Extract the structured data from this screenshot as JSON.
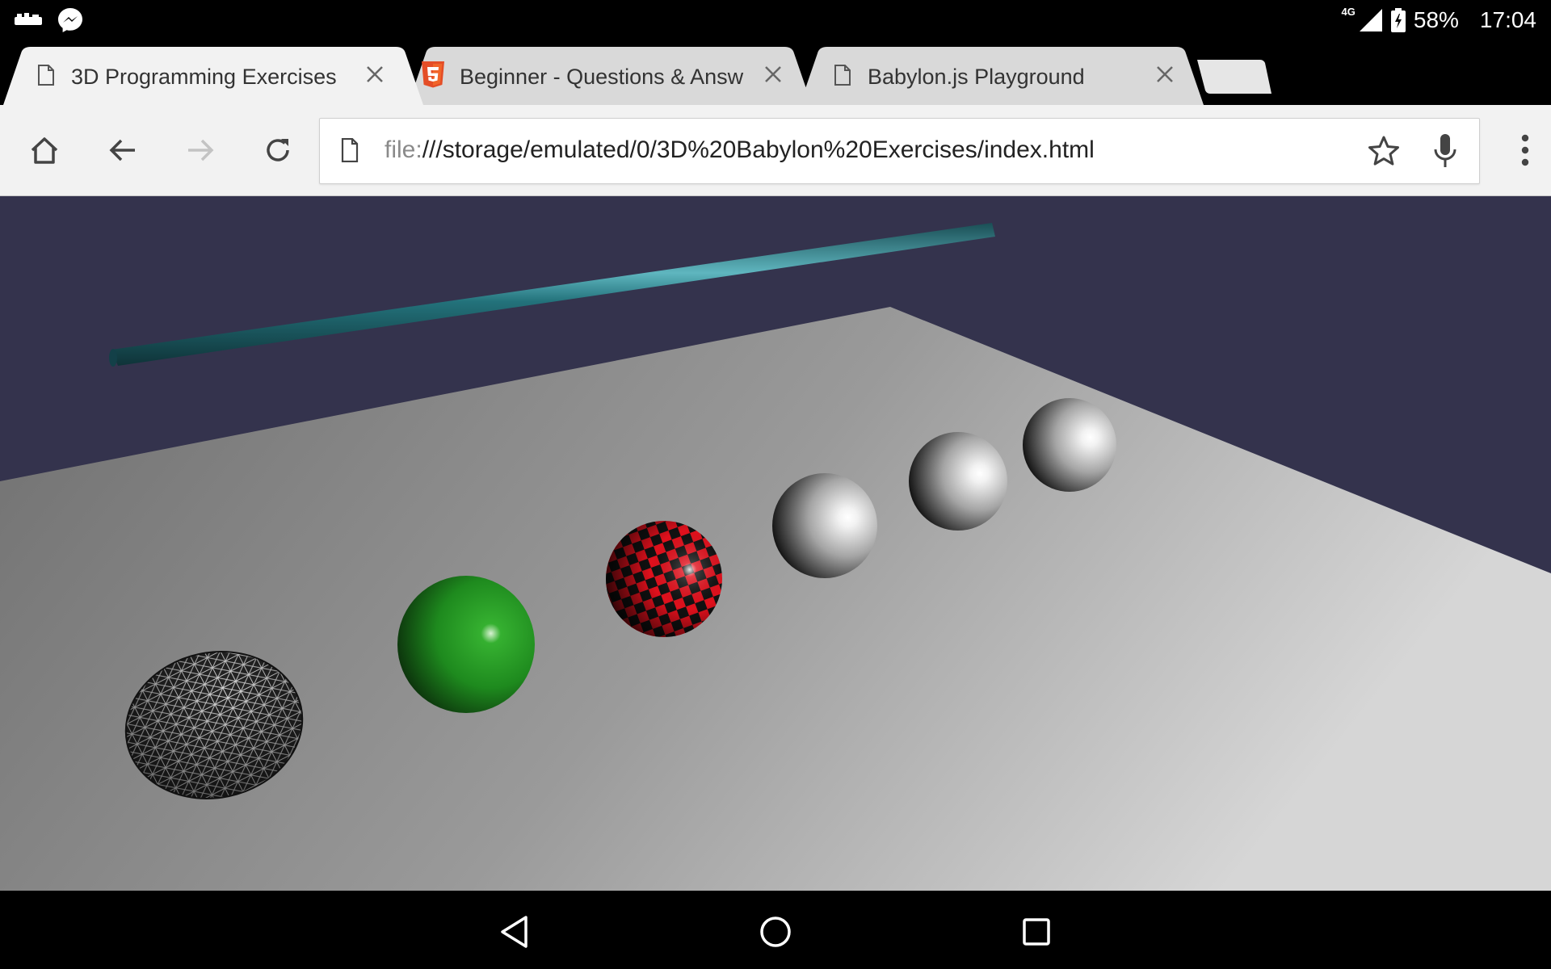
{
  "status_bar": {
    "network": "4G",
    "battery": "58%",
    "time": "17:04"
  },
  "tabs": [
    {
      "title": "3D Programming Exercises",
      "icon": "document-icon",
      "active": true
    },
    {
      "title": "Beginner - Questions & Answ",
      "icon": "html5-icon",
      "active": false
    },
    {
      "title": "Babylon.js Playground",
      "icon": "document-icon",
      "active": false
    }
  ],
  "toolbar": {
    "url_scheme": "file:",
    "url_rest": "///storage/emulated/0/3D%20Babylon%20Exercises/index.html"
  },
  "scene": {
    "background_color": "#34334d",
    "ground_color": "#9a9a9a",
    "rod_color": "#1f6f78",
    "spheres": [
      "wireframe",
      "green",
      "red-black-checker",
      "white",
      "white",
      "white"
    ]
  },
  "colors": {
    "html5_orange": "#e44d26",
    "tab_active": "#f2f2f2",
    "tab_inactive": "#d9d9d9"
  }
}
